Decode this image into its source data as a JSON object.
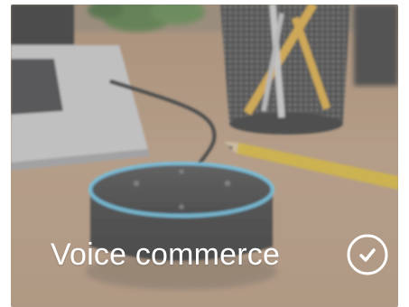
{
  "card": {
    "title": "Voice commerce",
    "action_icon": "check-circle-icon",
    "device_brand": "amazon",
    "colors": {
      "caption": "#ffffff",
      "icon": "#ffffff",
      "overlay": "#9a9a9a",
      "device_ring": "#6fd6ff"
    }
  }
}
